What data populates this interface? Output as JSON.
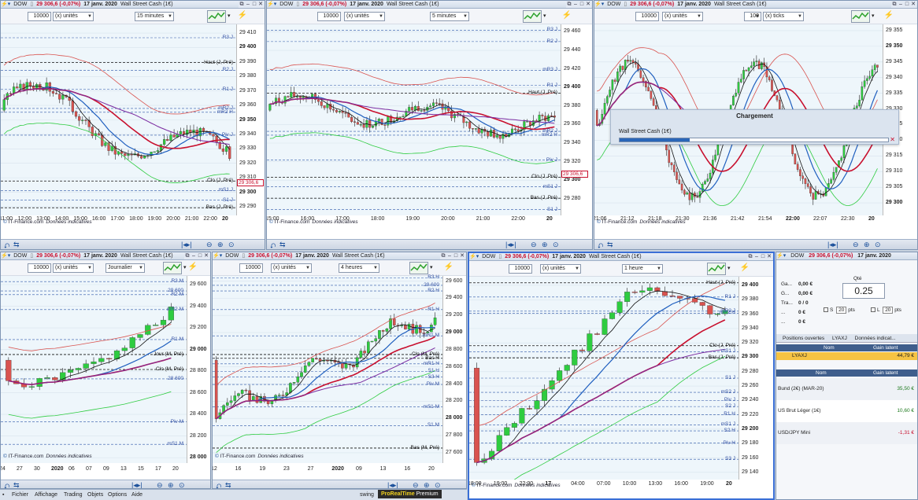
{
  "colors": {
    "up": "#2ecc40",
    "down": "#d9534f",
    "accent": "#3a6fd6",
    "price": "#c8102e"
  },
  "common": {
    "symbol": "DOW",
    "change": "29 306,6 (-0,07%)",
    "date": "17 janv. 2020",
    "instrument": "Wall Street Cash (1€)",
    "credit_brand": "IT-Finance.com",
    "credit_note": "Données indicatives",
    "qty": "10000",
    "unit": "(x) unités",
    "close_icon": "close-icon"
  },
  "charts": [
    {
      "id": "c1",
      "timeframe": "15 minutes",
      "price_tag": "29 306,6",
      "y_labels": [
        {
          "v": "29 410",
          "bold": false
        },
        {
          "v": "29 400",
          "bold": true
        },
        {
          "v": "29 390",
          "bold": false
        },
        {
          "v": "29 380",
          "bold": false
        },
        {
          "v": "29 370",
          "bold": false
        },
        {
          "v": "29 360",
          "bold": false
        },
        {
          "v": "29 350",
          "bold": true
        },
        {
          "v": "29 340",
          "bold": false
        },
        {
          "v": "29 330",
          "bold": false
        },
        {
          "v": "29 320",
          "bold": false
        },
        {
          "v": "29 310",
          "bold": false
        },
        {
          "v": "29 300",
          "bold": true
        },
        {
          "v": "29 290",
          "bold": false
        }
      ],
      "x_labels": [
        {
          "v": "11:00",
          "bold": false
        },
        {
          "v": "12:00",
          "bold": false
        },
        {
          "v": "13:00",
          "bold": false
        },
        {
          "v": "14:00",
          "bold": false
        },
        {
          "v": "15:00",
          "bold": false
        },
        {
          "v": "16:00",
          "bold": false
        },
        {
          "v": "17:00",
          "bold": false
        },
        {
          "v": "18:00",
          "bold": false
        },
        {
          "v": "19:00",
          "bold": false
        },
        {
          "v": "20:00",
          "bold": false
        },
        {
          "v": "21:00",
          "bold": false
        },
        {
          "v": "22:00",
          "bold": false
        },
        {
          "v": "20",
          "bold": true
        }
      ],
      "levels": [
        "R3 J",
        "Haut (J, Pré)",
        "R2 J",
        "R1 J",
        "mR2 J",
        "mR2 H",
        "Piv J",
        "Clo (J, Pré)",
        "mS1 J",
        "S1 J",
        "Bas (J, Pré)"
      ]
    },
    {
      "id": "c2",
      "timeframe": "5 minutes",
      "price_tag": "29 306,6",
      "y_labels": [
        {
          "v": "29 460",
          "bold": false
        },
        {
          "v": "29 440",
          "bold": false
        },
        {
          "v": "29 420",
          "bold": false
        },
        {
          "v": "29 400",
          "bold": true
        },
        {
          "v": "29 380",
          "bold": false
        },
        {
          "v": "29 360",
          "bold": false
        },
        {
          "v": "29 340",
          "bold": false
        },
        {
          "v": "29 320",
          "bold": false
        },
        {
          "v": "29 300",
          "bold": true
        },
        {
          "v": "29 280",
          "bold": false
        }
      ],
      "x_labels": [
        {
          "v": "15:00",
          "bold": false
        },
        {
          "v": "16:00",
          "bold": false
        },
        {
          "v": "17:00",
          "bold": false
        },
        {
          "v": "18:00",
          "bold": false
        },
        {
          "v": "19:00",
          "bold": false
        },
        {
          "v": "20:00",
          "bold": false
        },
        {
          "v": "21:00",
          "bold": false
        },
        {
          "v": "22:00",
          "bold": false
        },
        {
          "v": "20",
          "bold": true
        }
      ],
      "levels": [
        "R3 J",
        "R2 J",
        "mR3 J",
        "R1 J",
        "Haut (J, Pré)",
        "mR2 J",
        "mR2 H",
        "Piv J",
        "Clo (J, Pré)",
        "mS1 J",
        "Bas (J, Pré)",
        "S1 J"
      ]
    },
    {
      "id": "c3",
      "timeframe": "100",
      "unit": "(x) ticks",
      "y_labels": [
        {
          "v": "29 355",
          "bold": false
        },
        {
          "v": "29 350",
          "bold": true
        },
        {
          "v": "29 345",
          "bold": false
        },
        {
          "v": "29 340",
          "bold": false
        },
        {
          "v": "29 335",
          "bold": false
        },
        {
          "v": "29 330",
          "bold": false
        },
        {
          "v": "29 325",
          "bold": false
        },
        {
          "v": "29 320",
          "bold": false
        },
        {
          "v": "29 315",
          "bold": false
        },
        {
          "v": "29 310",
          "bold": false
        },
        {
          "v": "29 305",
          "bold": false
        },
        {
          "v": "29 300",
          "bold": true
        }
      ],
      "x_labels": [
        {
          "v": "21:06",
          "bold": false
        },
        {
          "v": "21:12",
          "bold": false
        },
        {
          "v": "21:18",
          "bold": false
        },
        {
          "v": "21:30",
          "bold": false
        },
        {
          "v": "21:36",
          "bold": false
        },
        {
          "v": "21:42",
          "bold": false
        },
        {
          "v": "21:54",
          "bold": false
        },
        {
          "v": "22:00",
          "bold": true
        },
        {
          "v": "22:07",
          "bold": false
        },
        {
          "v": "22:30",
          "bold": false
        },
        {
          "v": "20",
          "bold": true
        }
      ]
    },
    {
      "id": "c4",
      "timeframe": "Journalier",
      "y_labels": [
        {
          "v": "29 600",
          "bold": false
        },
        {
          "v": "29 400",
          "bold": false
        },
        {
          "v": "29 200",
          "bold": false
        },
        {
          "v": "29 000",
          "bold": true
        },
        {
          "v": "28 800",
          "bold": false
        },
        {
          "v": "28 600",
          "bold": false
        },
        {
          "v": "28 400",
          "bold": false
        },
        {
          "v": "28 200",
          "bold": false
        },
        {
          "v": "28 000",
          "bold": true
        }
      ],
      "x_labels": [
        {
          "v": "24",
          "bold": false
        },
        {
          "v": "27",
          "bold": false
        },
        {
          "v": "30",
          "bold": false
        },
        {
          "v": "2020",
          "bold": true
        },
        {
          "v": "06",
          "bold": false
        },
        {
          "v": "07",
          "bold": false
        },
        {
          "v": "09",
          "bold": false
        },
        {
          "v": "13",
          "bold": false
        },
        {
          "v": "15",
          "bold": false
        },
        {
          "v": "17",
          "bold": false
        },
        {
          "v": "20",
          "bold": false
        }
      ],
      "levels": [
        "R3 M",
        "29 600",
        "R2 M",
        "mR2 M",
        "R1 M",
        "Jour (M, Pré)",
        "Clo (M, Pré)",
        "28 600",
        "Piv M",
        "mS1 M"
      ]
    },
    {
      "id": "c5",
      "timeframe": "4 heures",
      "y_labels": [
        {
          "v": "29 600",
          "bold": false
        },
        {
          "v": "29 400",
          "bold": false
        },
        {
          "v": "29 200",
          "bold": false
        },
        {
          "v": "29 000",
          "bold": true
        },
        {
          "v": "28 800",
          "bold": false
        },
        {
          "v": "28 600",
          "bold": false
        },
        {
          "v": "28 400",
          "bold": false
        },
        {
          "v": "28 200",
          "bold": false
        },
        {
          "v": "28 000",
          "bold": true
        },
        {
          "v": "27 800",
          "bold": false
        },
        {
          "v": "27 600",
          "bold": false
        }
      ],
      "x_labels": [
        {
          "v": "12",
          "bold": false
        },
        {
          "v": "16",
          "bold": false
        },
        {
          "v": "19",
          "bold": false
        },
        {
          "v": "23",
          "bold": false
        },
        {
          "v": "27",
          "bold": false
        },
        {
          "v": "2020",
          "bold": true
        },
        {
          "v": "09",
          "bold": false
        },
        {
          "v": "13",
          "bold": false
        },
        {
          "v": "16",
          "bold": false
        },
        {
          "v": "20",
          "bold": false
        }
      ],
      "levels": [
        "R3 H",
        "29 600",
        "R2 H",
        "R1 H",
        "mR1 M",
        "Clo (M, Pré)",
        "Bas H",
        "mR1 H",
        "S1 H",
        "S3 H",
        "Piv M",
        "mS1 M",
        "S1 M",
        "Bas (M, Pré)"
      ]
    },
    {
      "id": "c6",
      "timeframe": "1 heure",
      "y_labels": [
        {
          "v": "29 400",
          "bold": true
        },
        {
          "v": "29 380",
          "bold": false
        },
        {
          "v": "29 360",
          "bold": false
        },
        {
          "v": "29 340",
          "bold": false
        },
        {
          "v": "29 320",
          "bold": false
        },
        {
          "v": "29 300",
          "bold": true
        },
        {
          "v": "29 280",
          "bold": false
        },
        {
          "v": "29 260",
          "bold": false
        },
        {
          "v": "29 240",
          "bold": false
        },
        {
          "v": "29 220",
          "bold": false
        },
        {
          "v": "29 200",
          "bold": true
        },
        {
          "v": "29 180",
          "bold": false
        },
        {
          "v": "29 160",
          "bold": false
        },
        {
          "v": "29 140",
          "bold": false
        }
      ],
      "x_labels": [
        {
          "v": "18:00",
          "bold": false
        },
        {
          "v": "19:00",
          "bold": false
        },
        {
          "v": "22:00",
          "bold": false
        },
        {
          "v": "17",
          "bold": true
        },
        {
          "v": "04:00",
          "bold": false
        },
        {
          "v": "07:00",
          "bold": false
        },
        {
          "v": "10:00",
          "bold": false
        },
        {
          "v": "13:00",
          "bold": false
        },
        {
          "v": "16:00",
          "bold": false
        },
        {
          "v": "19:00",
          "bold": false
        },
        {
          "v": "20",
          "bold": true
        }
      ],
      "levels": [
        "Haut (J, Pré)",
        "R1 J",
        "mR2 J",
        "mR2 H",
        "Clo (J, Pré)",
        "mS1 J",
        "Bas (J, Pré)",
        "S1 J",
        "mS2 J",
        "Piv J",
        "S2 J",
        "R1 H",
        "mS1 J",
        "S2 H",
        "Piv H",
        "S3 J"
      ]
    }
  ],
  "loading": {
    "title": "Chargement",
    "label": "Wall Street Cash (1€)",
    "progress": 0.26
  },
  "order_panel": {
    "rows": [
      {
        "k": "Ga...",
        "v": "0,00 €"
      },
      {
        "k": "G...",
        "v": "0,00 €"
      },
      {
        "k": "Tra...",
        "v": "0 / 0"
      },
      {
        "k": "...",
        "v": "0 €"
      },
      {
        "k": "...",
        "v": "0 €"
      }
    ],
    "qty_label": "Qté",
    "qty": "0.25",
    "stop_label": "S",
    "stop_val": "20",
    "stop_unit": "pts",
    "limit_label": "L",
    "limit_val": "20",
    "limit_unit": "pts",
    "tabs": [
      "Positions ouvertes",
      "LYAXJ",
      "Données indicat..."
    ],
    "pos_headers": [
      "Nom",
      "Gain latent"
    ],
    "positions": [
      {
        "name": "LYAXJ",
        "gain": "44,79 €"
      }
    ],
    "watch_headers": [
      "Nom",
      "Gain latent"
    ],
    "watch": [
      {
        "name": "Bund (2€) (MAR-20)",
        "gain": "35,50 €"
      },
      {
        "name": "US Brut Léger (1€)",
        "gain": "10,60 €"
      },
      {
        "name": "USD/JPY Mini",
        "gain": "-1,31 €"
      }
    ]
  },
  "menu": {
    "items": [
      "Fichier",
      "Affichage",
      "Trading",
      "Objets",
      "Options",
      "Aide"
    ],
    "mode": "swing",
    "brand_a": "ProRealTime",
    "brand_b": "Premium"
  }
}
